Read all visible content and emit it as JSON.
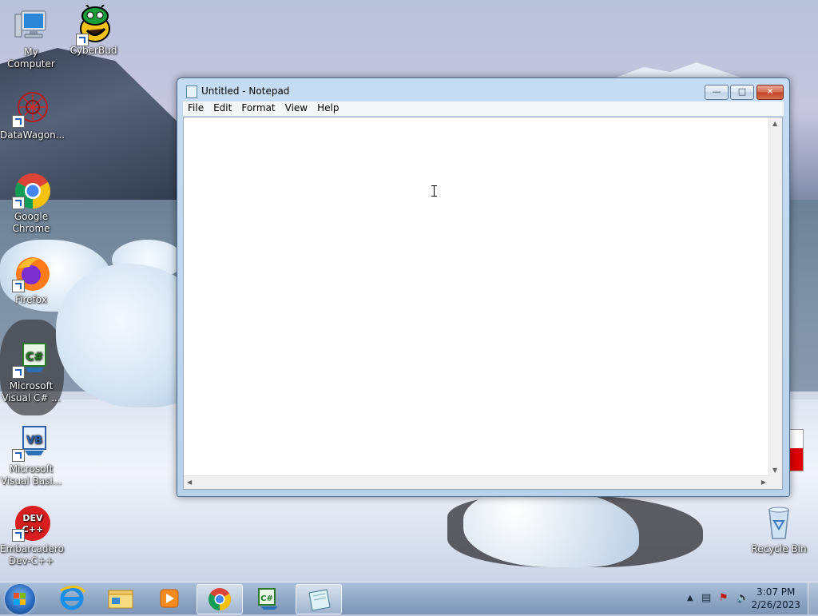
{
  "desktop": {
    "icons": [
      {
        "label": "My Computer",
        "icon": "computer-icon"
      },
      {
        "label": "CyberBud",
        "icon": "alien-icon"
      },
      {
        "label": "DataWagon...",
        "icon": "datawagon-icon"
      },
      {
        "label": "Google Chrome",
        "icon": "chrome-icon"
      },
      {
        "label": "Firefox",
        "icon": "firefox-icon"
      },
      {
        "label": "Microsoft Visual C# ...",
        "icon": "csharp-icon"
      },
      {
        "label": "Microsoft Visual Basi...",
        "icon": "vb-icon"
      },
      {
        "label": "Embarcadero Dev-C++",
        "icon": "devcpp-icon"
      },
      {
        "label": "Recycle Bin",
        "icon": "recycle-bin-icon"
      }
    ]
  },
  "notepad": {
    "title": "Untitled - Notepad",
    "menu": [
      "File",
      "Edit",
      "Format",
      "View",
      "Help"
    ],
    "content": ""
  },
  "taskbar": {
    "clock_time": "3:07 PM",
    "clock_date": "2/26/2023",
    "pinned": [
      "internet-explorer-icon",
      "windows-explorer-icon",
      "media-player-icon",
      "chrome-icon",
      "visual-csharp-icon",
      "notepad-icon"
    ]
  }
}
